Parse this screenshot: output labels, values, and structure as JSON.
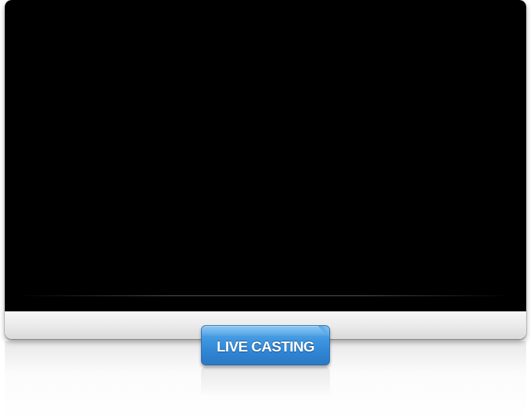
{
  "player": {
    "button_label": "LIVE CASTING"
  },
  "colors": {
    "screen": "#000000",
    "bezel": "#ececec",
    "button_accent": "#3f97e0",
    "button_text": "#ffffff"
  },
  "icons": {
    "speaker": "speaker-grille-icon"
  }
}
